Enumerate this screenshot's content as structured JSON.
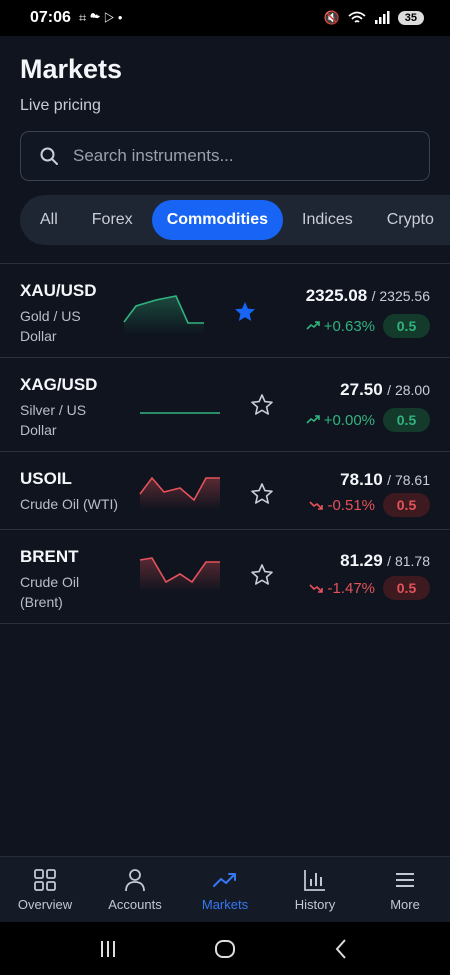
{
  "status_bar": {
    "time": "07:06",
    "left_glyphs": "⌗ ☁ ▷ •",
    "battery": "35"
  },
  "header": {
    "title": "Markets",
    "subtitle": "Live pricing"
  },
  "search": {
    "placeholder": "Search instruments..."
  },
  "tabs": [
    {
      "label": "All",
      "active": false
    },
    {
      "label": "Forex",
      "active": false
    },
    {
      "label": "Commodities",
      "active": true
    },
    {
      "label": "Indices",
      "active": false
    },
    {
      "label": "Crypto",
      "active": false
    }
  ],
  "instruments": [
    {
      "symbol": "XAU/USD",
      "name": "Gold / US Dollar",
      "price": "2325.08",
      "prev": "/ 2325.56",
      "change": "+0.63%",
      "direction": "up",
      "spread": "0.5",
      "favorite": true
    },
    {
      "symbol": "XAG/USD",
      "name": "Silver / US Dollar",
      "price": "27.50",
      "prev": "/ 28.00",
      "change": "+0.00%",
      "direction": "up",
      "spread": "0.5",
      "favorite": false
    },
    {
      "symbol": "USOIL",
      "name": "Crude Oil (WTI)",
      "price": "78.10",
      "prev": "/ 78.61",
      "change": "-0.51%",
      "direction": "down",
      "spread": "0.5",
      "favorite": false
    },
    {
      "symbol": "BRENT",
      "name": "Crude Oil (Brent)",
      "price": "81.29",
      "prev": "/ 81.78",
      "change": "-1.47%",
      "direction": "down",
      "spread": "0.5",
      "favorite": false
    }
  ],
  "bottom_nav": [
    {
      "label": "Overview",
      "icon": "grid-icon",
      "active": false
    },
    {
      "label": "Accounts",
      "icon": "user-icon",
      "active": false
    },
    {
      "label": "Markets",
      "icon": "trending-icon",
      "active": true
    },
    {
      "label": "History",
      "icon": "bar-chart-icon",
      "active": false
    },
    {
      "label": "More",
      "icon": "menu-icon",
      "active": false
    }
  ],
  "colors": {
    "accent": "#1764f5",
    "up": "#31b37e",
    "down": "#e5525a",
    "background": "#0f141e"
  }
}
